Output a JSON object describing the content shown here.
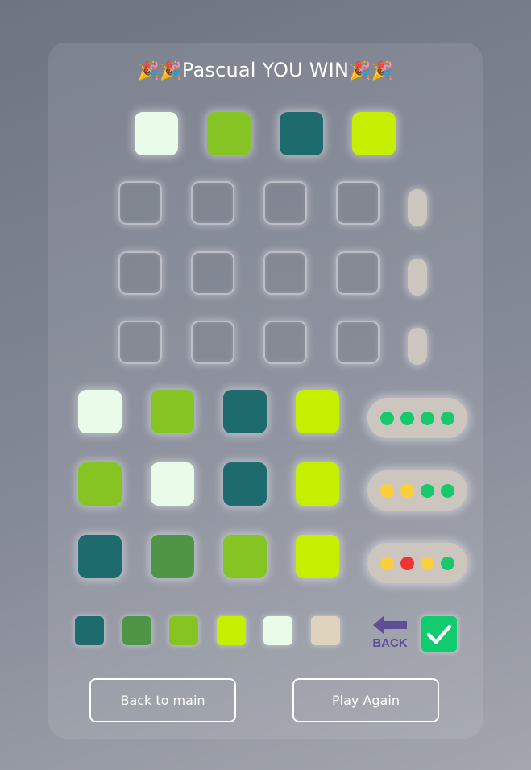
{
  "title": {
    "emoji_left": "🎉🎉",
    "text": "Pascual YOU WIN",
    "emoji_right": "🎉🎉"
  },
  "colors": {
    "white": "#e9fbe9",
    "lime": "#86c424",
    "teal": "#1d6b6c",
    "green": "#4e9646",
    "chartreuse": "#c4f000",
    "beige": "#dfd3bc",
    "peg_green": "#16c96a",
    "peg_yellow": "#fbcf3a",
    "peg_red": "#ef3534"
  },
  "secret_code": [
    "white",
    "lime",
    "teal",
    "chartreuse"
  ],
  "guesses": [
    {
      "pegs": [
        "white",
        "lime",
        "teal",
        "chartreuse"
      ],
      "feedback": [
        "peg_green",
        "peg_green",
        "peg_green",
        "peg_green"
      ]
    },
    {
      "pegs": [
        "lime",
        "white",
        "teal",
        "chartreuse"
      ],
      "feedback": [
        "peg_yellow",
        "peg_yellow",
        "peg_green",
        "peg_green"
      ]
    },
    {
      "pegs": [
        "teal",
        "green",
        "lime",
        "chartreuse"
      ],
      "feedback": [
        "peg_yellow",
        "peg_red",
        "peg_yellow",
        "peg_green"
      ]
    }
  ],
  "palette": [
    "teal",
    "green",
    "lime",
    "chartreuse",
    "white",
    "beige"
  ],
  "controls": {
    "back_label": "BACK",
    "back_to_main": "Back to main",
    "play_again": "Play Again"
  }
}
